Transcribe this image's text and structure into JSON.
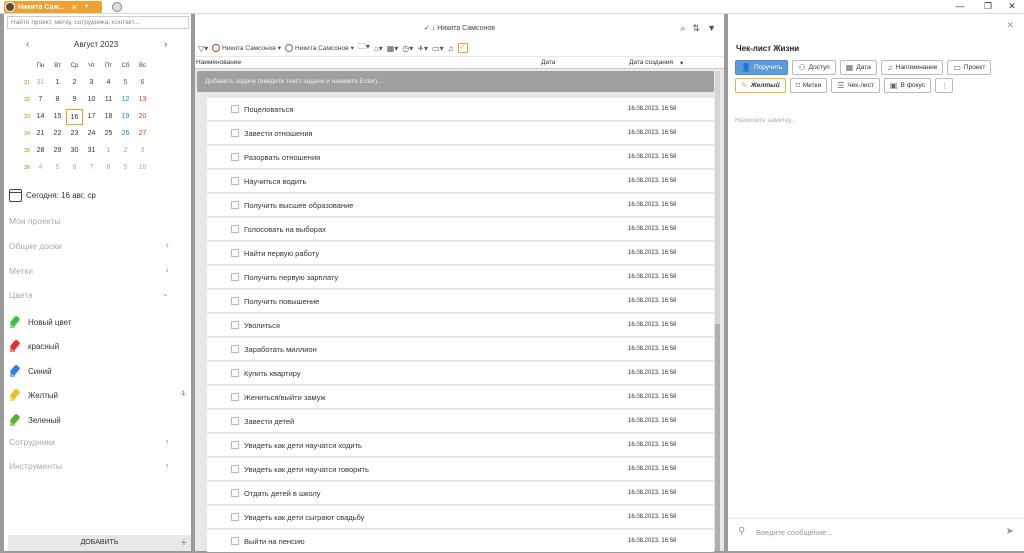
{
  "titlebar": {
    "user_name": "Никита Сам...",
    "win_min": "—",
    "win_restore": "❐",
    "win_close": "✕"
  },
  "left": {
    "search_placeholder": "Найти проект, метку, сотрудника, контакт...",
    "calendar": {
      "month": "Август 2023",
      "prev": "‹",
      "next": "›",
      "weekdays": [
        "Пн",
        "Вт",
        "Ср",
        "Чт",
        "Пт",
        "Сб",
        "Вс"
      ],
      "weeks": [
        {
          "wk": "31",
          "days": [
            "31",
            "1",
            "2",
            "3",
            "4",
            "5",
            "6"
          ]
        },
        {
          "wk": "32",
          "days": [
            "7",
            "8",
            "9",
            "10",
            "11",
            "12",
            "13"
          ]
        },
        {
          "wk": "33",
          "days": [
            "14",
            "15",
            "16",
            "17",
            "18",
            "19",
            "20"
          ]
        },
        {
          "wk": "34",
          "days": [
            "21",
            "22",
            "23",
            "24",
            "25",
            "26",
            "27"
          ]
        },
        {
          "wk": "35",
          "days": [
            "28",
            "29",
            "30",
            "31",
            "1",
            "2",
            "3"
          ]
        },
        {
          "wk": "36",
          "days": [
            "4",
            "5",
            "6",
            "7",
            "8",
            "9",
            "10"
          ]
        }
      ]
    },
    "today_label": "Сегодня: 16 авг, ср",
    "nav": {
      "my_projects": "Мои проекты",
      "shared_boards": "Общие доски",
      "tags": "Метки",
      "colors": "Цвета",
      "employees": "Сотрудники",
      "tools": "Инструменты"
    },
    "colors": [
      {
        "label": "Новый цвет",
        "color": "#40c040"
      },
      {
        "label": "красный",
        "color": "#e03030"
      },
      {
        "label": "Синий",
        "color": "#3080e0"
      },
      {
        "label": "Желтый",
        "color": "#f0c020",
        "count": "1"
      },
      {
        "label": "Зеленый",
        "color": "#60b030"
      }
    ],
    "add_button": "ДОБАВИТЬ",
    "add_plus": "+"
  },
  "center": {
    "filter_user": "✓ ↓ Никита Самсонов",
    "toolbar": {
      "chip1": "Никита Самсонов",
      "chip2": "Никита Самсонов",
      "check": "✓"
    },
    "columns": {
      "name": "Наименование",
      "date": "Дата",
      "created": "Дата создания"
    },
    "add_task_placeholder": "Добавить задачу (введите текст задачи и нажмите Enter)...",
    "tasks": [
      {
        "name": "Поцеловаться",
        "created": "16.08.2023, 16:58"
      },
      {
        "name": "Завести отношения",
        "created": "16.08.2023, 16:58"
      },
      {
        "name": "Разорвать отношения",
        "created": "16.08.2023, 16:58"
      },
      {
        "name": "Научиться водить",
        "created": "16.08.2023, 16:58"
      },
      {
        "name": "Получить высшее образование",
        "created": "16.08.2023, 16:58"
      },
      {
        "name": "Голосовать на выборах",
        "created": "16.08.2023, 16:58"
      },
      {
        "name": "Найти первую работу",
        "created": "16.08.2023, 16:58"
      },
      {
        "name": "Получить первую зарплату",
        "created": "16.08.2023, 16:58"
      },
      {
        "name": "Получить повышение",
        "created": "16.08.2023, 16:58"
      },
      {
        "name": "Уволиться",
        "created": "16.08.2023, 16:58"
      },
      {
        "name": "Заработать миллион",
        "created": "16.08.2023, 16:58"
      },
      {
        "name": "Купить квартиру",
        "created": "16.08.2023, 16:58"
      },
      {
        "name": "Жениться/выйти замуж",
        "created": "16.08.2023, 16:58"
      },
      {
        "name": "Завести детей",
        "created": "16.08.2023, 16:58"
      },
      {
        "name": "Увидеть как дети научатся ходить",
        "created": "16.08.2023, 16:58"
      },
      {
        "name": "Увидеть как дети научатся говорить",
        "created": "16.08.2023, 16:58"
      },
      {
        "name": "Отдать детей в школу",
        "created": "16.08.2023, 16:58"
      },
      {
        "name": "Увидеть как дети сыграют свадьбу",
        "created": "16.08.2023, 16:58"
      },
      {
        "name": "Выйти на пенсию",
        "created": "16.08.2023, 16:58"
      }
    ]
  },
  "right": {
    "close": "✕",
    "title": "Чек-лист Жизни",
    "buttons_row1": [
      {
        "label": "Поручить",
        "icon": "person-icon",
        "active": true
      },
      {
        "label": "Доступ",
        "icon": "people-icon"
      },
      {
        "label": "Дата",
        "icon": "calendar-icon"
      },
      {
        "label": "Напоминание",
        "icon": "bell-icon"
      },
      {
        "label": "Проект",
        "icon": "folder-icon"
      }
    ],
    "buttons_row2": [
      {
        "label": "Желтый",
        "icon": "marker-icon",
        "yellow": true
      },
      {
        "label": "Метки",
        "icon": "tag-icon"
      },
      {
        "label": "Чек-лист",
        "icon": "checklist-icon"
      },
      {
        "label": "В фокус",
        "icon": "focus-icon"
      },
      {
        "label": "⋮",
        "icon": "more-icon"
      }
    ],
    "note_placeholder": "Напишите заметку...",
    "message_placeholder": "Введите сообщение..."
  }
}
